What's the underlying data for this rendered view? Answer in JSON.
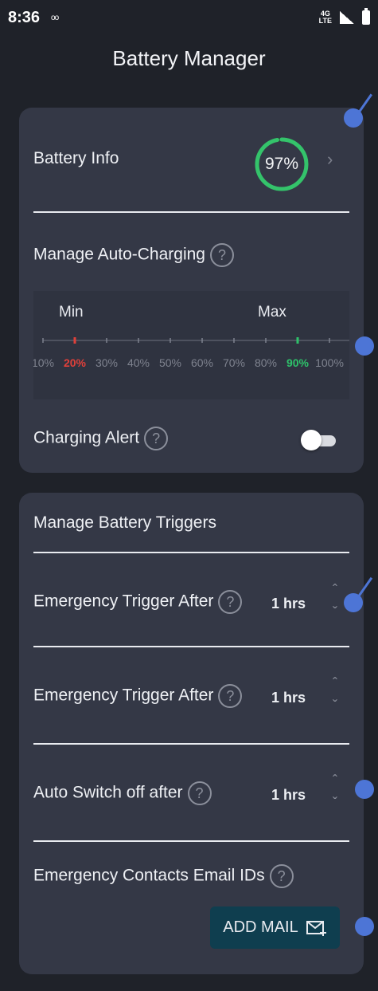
{
  "status_bar": {
    "time": "8:36",
    "voicemail_icon": "voicemail-icon",
    "network": "4G",
    "network_sub": "LTE"
  },
  "header": {
    "title": "Battery Manager"
  },
  "battery_card": {
    "battery_info_label": "Battery Info",
    "battery_percent": 97,
    "battery_percent_text": "97%",
    "gauge_color": "#34c36b",
    "auto_charging_label": "Manage Auto-Charging",
    "range": {
      "min_label": "Min",
      "max_label": "Max",
      "ticks": [
        "10%",
        "20%",
        "30%",
        "40%",
        "50%",
        "60%",
        "70%",
        "80%",
        "90%",
        "100%"
      ],
      "min_selected": "20%",
      "max_selected": "90%",
      "min_color": "#e0403a",
      "max_color": "#2ec26a"
    },
    "charging_alert_label": "Charging Alert",
    "charging_alert_on": false
  },
  "triggers_card": {
    "title": "Manage Battery Triggers",
    "rows": [
      {
        "label": "Emergency Trigger After",
        "value": "1 hrs"
      },
      {
        "label": "Emergency Trigger After",
        "value": "1 hrs"
      },
      {
        "label": "Auto Switch off after",
        "value": "1 hrs"
      }
    ],
    "emails_label": "Emergency Contacts Email IDs",
    "add_mail_label": "ADD MAIL"
  },
  "colors": {
    "background": "#1f2229",
    "card": "#343846",
    "button": "#0f3e4f",
    "marker": "#4d75d6"
  }
}
